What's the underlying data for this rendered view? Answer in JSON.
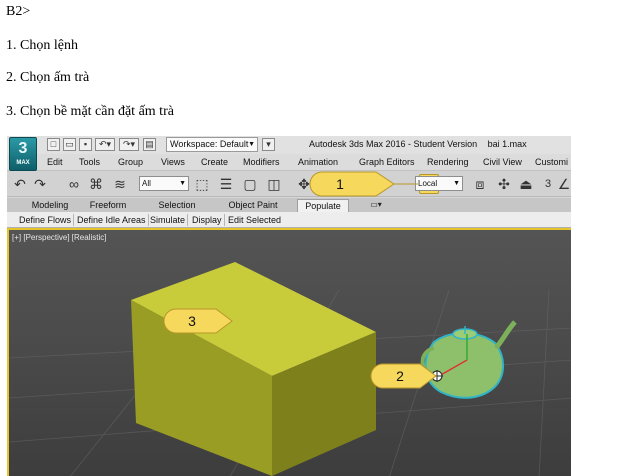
{
  "document": {
    "lines": [
      "B2>",
      "1. Chọn lệnh",
      "2. Chọn ấm trà",
      "3. Chọn bề mặt cần đặt ấm trà"
    ]
  },
  "app": {
    "logo_text": "MAX",
    "workspace_label": "Workspace: Default",
    "title_parts": [
      "Autodesk 3ds Max 2016 - Student Version",
      "bai 1.max"
    ],
    "menu": [
      "Edit",
      "Tools",
      "Group",
      "Views",
      "Create",
      "Modifiers",
      "Animation",
      "Graph Editors",
      "Rendering",
      "Civil View",
      "Customi"
    ],
    "toolbar": {
      "filter_value": "All",
      "coord_value": "Local",
      "snap_count": "3"
    },
    "ribbon_tabs": [
      "Modeling",
      "Freeform",
      "Selection",
      "Object Paint",
      "Populate"
    ],
    "ribbon_active": "Populate",
    "ribbon_buttons": [
      "Define Flows",
      "Define Idle Areas",
      "Simulate",
      "Display",
      "Edit Selected"
    ],
    "viewport_label": "[+] [Perspective] [Realistic]"
  },
  "callouts": [
    "1",
    "2",
    "3"
  ],
  "colors": {
    "accent_yellow": "#f5d85c",
    "viewport_border": "#e5c32b",
    "box_top": "#c9cc3a",
    "teapot": "#8ec06b",
    "teapot_outline": "#2fb4c8"
  }
}
